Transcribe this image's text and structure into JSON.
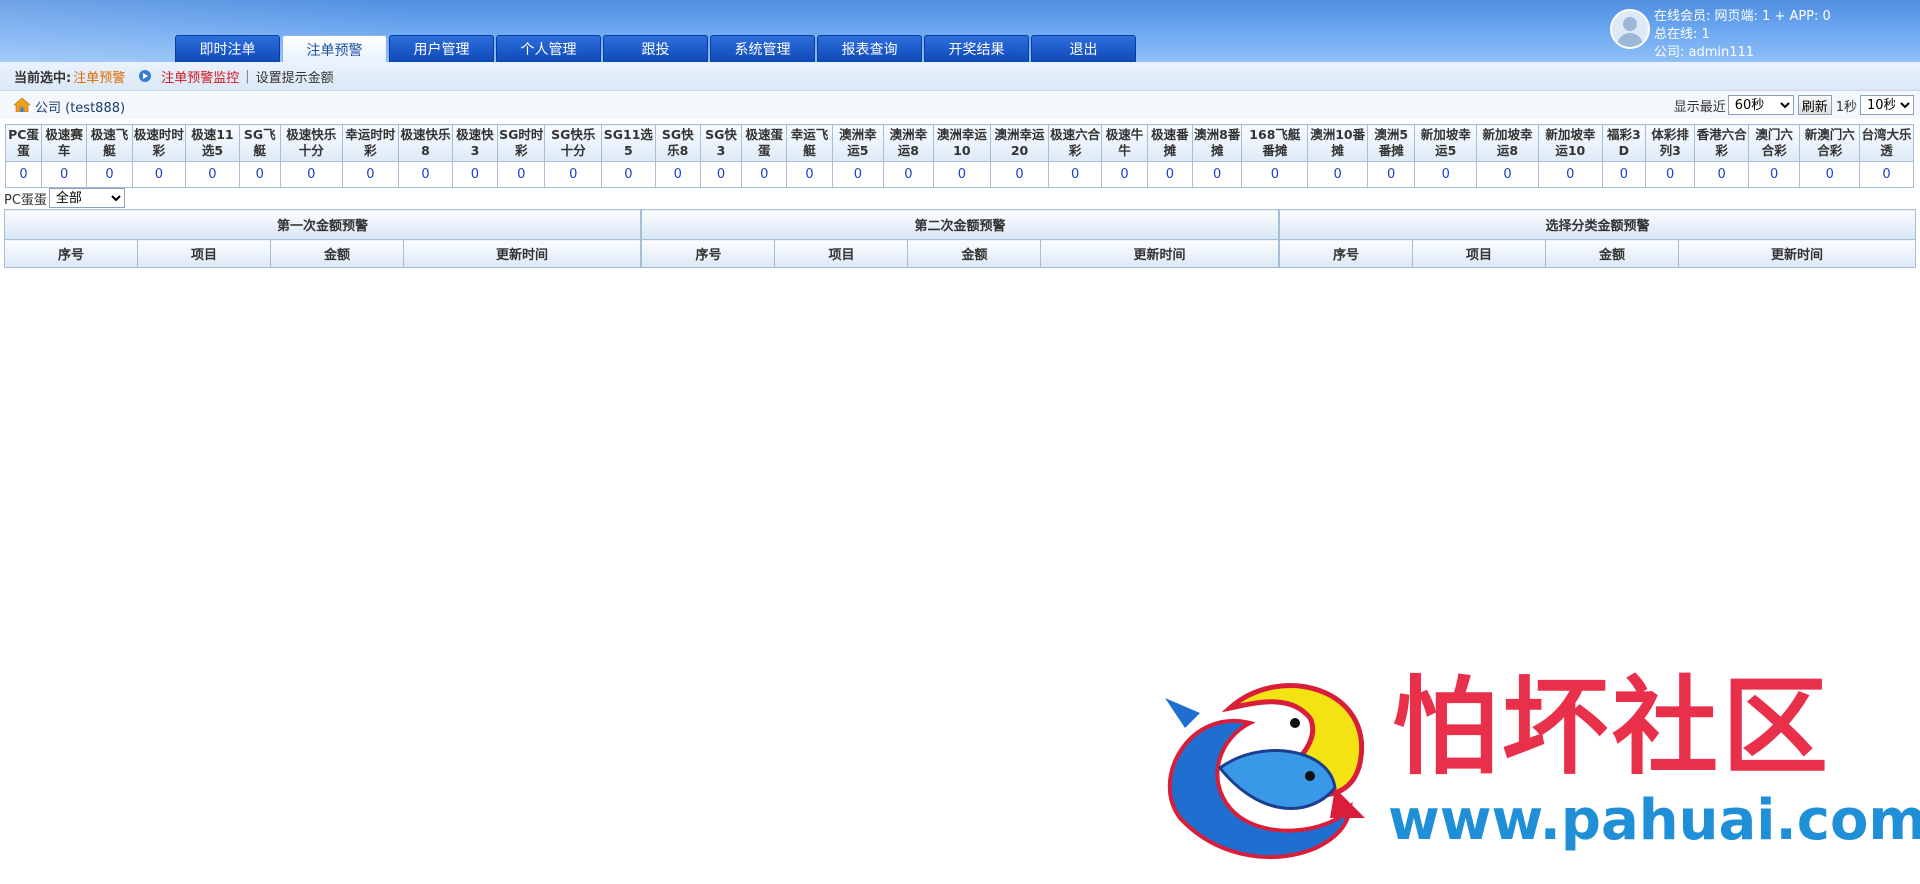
{
  "header": {
    "nav_tabs": [
      {
        "label": "即时注单",
        "active": false
      },
      {
        "label": "注单预警",
        "active": true
      },
      {
        "label": "用户管理",
        "active": false
      },
      {
        "label": "个人管理",
        "active": false
      },
      {
        "label": "跟投",
        "active": false
      },
      {
        "label": "系统管理",
        "active": false
      },
      {
        "label": "报表查询",
        "active": false
      },
      {
        "label": "开奖结果",
        "active": false
      },
      {
        "label": "退出",
        "active": false
      }
    ],
    "user": {
      "online_line": "在线会员:   网页端: 1 + APP: 0",
      "total_line": "总在线:  1",
      "company_line": "公司:  admin111"
    }
  },
  "breadcrumb": {
    "label": "当前选中:",
    "current": "注单预警",
    "link1": "注单预警监控",
    "separator": "|",
    "link2": "设置提示金额"
  },
  "company": {
    "name": "公司 (test888)",
    "show_recent_label": "显示最近",
    "recent_select": "60秒",
    "refresh_button": "刷新",
    "interval_label": "1秒",
    "interval_select": "10秒"
  },
  "games": {
    "headers": [
      "PC蛋蛋",
      "极速赛车",
      "极速飞艇",
      "极速时时彩",
      "极速11选5",
      "SG飞艇",
      "极速快乐十分",
      "幸运时时彩",
      "极速快乐8",
      "极速快3",
      "SG时时彩",
      "SG快乐十分",
      "SG11选5",
      "SG快乐8",
      "SG快3",
      "极速蛋蛋",
      "幸运飞艇",
      "澳洲幸运5",
      "澳洲幸运8",
      "澳洲幸运10",
      "澳洲幸运20",
      "极速六合彩",
      "极速牛牛",
      "极速番摊",
      "澳洲8番摊",
      "168飞艇番摊",
      "澳洲10番摊",
      "澳洲5番摊",
      "新加坡幸运5",
      "新加坡幸运8",
      "新加坡幸运10",
      "福彩3D",
      "体彩排列3",
      "香港六合彩",
      "澳门六合彩",
      "新澳门六合彩",
      "台湾大乐透"
    ],
    "values": [
      "0",
      "0",
      "0",
      "0",
      "0",
      "0",
      "0",
      "0",
      "0",
      "0",
      "0",
      "0",
      "0",
      "0",
      "0",
      "0",
      "0",
      "0",
      "0",
      "0",
      "0",
      "0",
      "0",
      "0",
      "0",
      "0",
      "0",
      "0",
      "0",
      "0",
      "0",
      "0",
      "0",
      "0",
      "0",
      "0",
      "0"
    ]
  },
  "filter": {
    "label": "PC蛋蛋",
    "select": "全部"
  },
  "panels": [
    {
      "title": "第一次金额预警",
      "columns": [
        "序号",
        "项目",
        "金额",
        "更新时间"
      ]
    },
    {
      "title": "第二次金额预警",
      "columns": [
        "序号",
        "项目",
        "金额",
        "更新时间"
      ]
    },
    {
      "title": "选择分类金额预警",
      "columns": [
        "序号",
        "项目",
        "金额",
        "更新时间"
      ]
    }
  ],
  "watermark": {
    "title": "怕坏社区",
    "url": "www.pahuai.com"
  }
}
